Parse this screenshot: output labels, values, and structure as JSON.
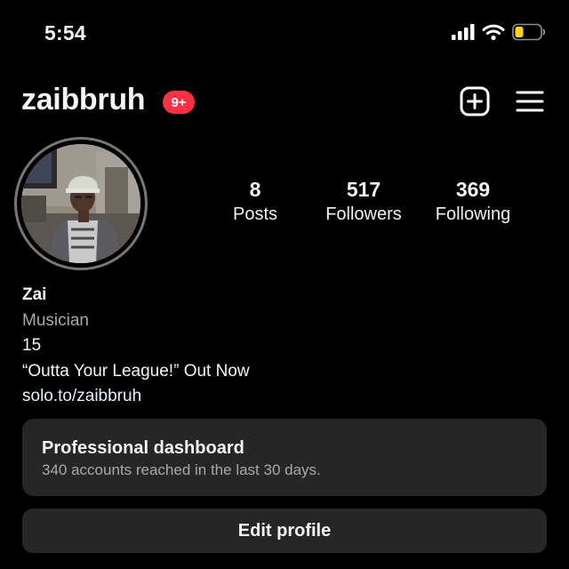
{
  "status_bar": {
    "time": "5:54",
    "icons": [
      "cellular-signal-icon",
      "wifi-icon",
      "battery-icon"
    ],
    "battery_color": "#ffd60a"
  },
  "header": {
    "username": "zaibbruh",
    "notification_badge": "9+",
    "badge_color": "#ff3040",
    "actions": [
      "create-post-icon",
      "menu-icon"
    ]
  },
  "profile": {
    "stats": {
      "posts": {
        "value": "8",
        "label": "Posts"
      },
      "followers": {
        "value": "517",
        "label": "Followers"
      },
      "following": {
        "value": "369",
        "label": "Following"
      }
    },
    "bio": {
      "name": "Zai",
      "category": "Musician",
      "line1": "15",
      "line2": "“Outta Your League!” Out Now",
      "link": "solo.to/zaibbruh"
    }
  },
  "dashboard": {
    "title": "Professional dashboard",
    "subtitle": "340 accounts reached in the last 30 days."
  },
  "edit_profile": {
    "label": "Edit profile"
  },
  "colors": {
    "background": "#000000",
    "card": "#262626",
    "secondary_text": "#a8a8a8"
  }
}
